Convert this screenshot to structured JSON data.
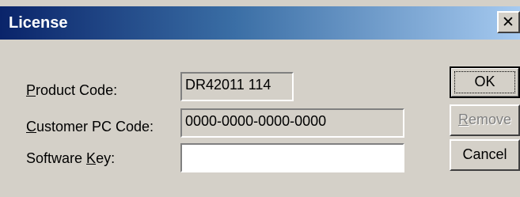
{
  "window": {
    "title": "License",
    "close_glyph": "✕",
    "titlebar_colors": [
      "#0a246a",
      "#3a6ea5",
      "#a6caf0"
    ],
    "face_color": "#d4d0c8"
  },
  "fields": {
    "product_code": {
      "label_mnemonic": "P",
      "label_rest": "roduct Code:",
      "value": "DR42011 114"
    },
    "customer_pc_code": {
      "label_mnemonic": "C",
      "label_rest": "ustomer PC Code:",
      "value": "0000-0000-0000-0000"
    },
    "software_key": {
      "label_before": "Software ",
      "label_mnemonic": "K",
      "label_after": "ey:",
      "value": ""
    }
  },
  "buttons": {
    "ok": {
      "label": "OK"
    },
    "remove": {
      "label_mnemonic": "R",
      "label_rest": "emove",
      "disabled": true
    },
    "cancel": {
      "label": "Cancel"
    }
  }
}
